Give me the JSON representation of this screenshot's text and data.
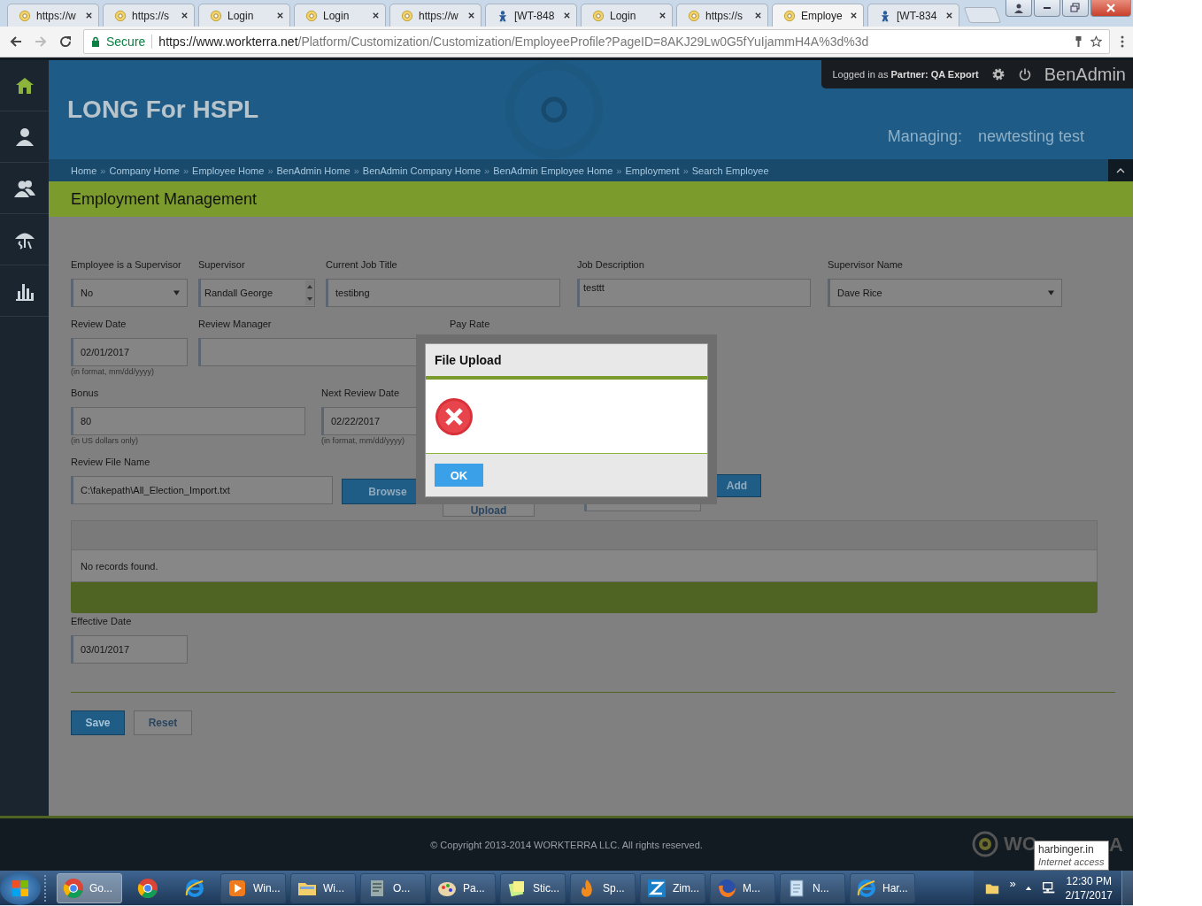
{
  "browser": {
    "tabs": [
      {
        "title": "https://w",
        "kind": "site",
        "selected": false
      },
      {
        "title": "https://s",
        "kind": "site",
        "selected": false
      },
      {
        "title": "Login",
        "kind": "site",
        "selected": false
      },
      {
        "title": "Login",
        "kind": "site",
        "selected": false
      },
      {
        "title": "https://w",
        "kind": "site",
        "selected": false
      },
      {
        "title": "[WT-848",
        "kind": "tracker",
        "selected": false
      },
      {
        "title": "Login",
        "kind": "site",
        "selected": false
      },
      {
        "title": "https://s",
        "kind": "site",
        "selected": false
      },
      {
        "title": "Employe",
        "kind": "site",
        "selected": true
      },
      {
        "title": "[WT-834",
        "kind": "tracker",
        "selected": false
      }
    ],
    "secure_label": "Secure",
    "url_host": "https://www.workterra.net",
    "url_path": "/Platform/Customization/Customization/EmployeeProfile?PageID=8AKJ29Lw0G5fYuIjammH4A%3d%3d"
  },
  "sidebar": {
    "items": [
      {
        "kind": "home",
        "selected": true
      },
      {
        "kind": "person",
        "selected": false
      },
      {
        "kind": "people",
        "selected": false
      },
      {
        "kind": "umbrella",
        "selected": false
      },
      {
        "kind": "chart",
        "selected": false
      }
    ]
  },
  "header": {
    "title": "LONG For HSPL",
    "login": "Logged in as **Partner:  QA Export**",
    "app_name": "BenAdmin",
    "managing_label": "Managing:",
    "managing_value": "newtesting test"
  },
  "breadcrumbs": [
    {
      "label": "Home",
      "separator": "»"
    },
    {
      "label": "Company Home",
      "separator": "»"
    },
    {
      "label": "Employee Home",
      "separator": "»"
    },
    {
      "label": "BenAdmin Home",
      "separator": "»"
    },
    {
      "label": "BenAdmin Company Home",
      "separator": "»"
    },
    {
      "label": "BenAdmin Employee Home",
      "separator": "»"
    },
    {
      "label": "Employment",
      "separator": "»"
    },
    {
      "label": "Search Employee"
    }
  ],
  "section_title": "Employment Management",
  "form": {
    "rows": [
      [
        {
          "label": "Employee is a Supervisor",
          "value": "No",
          "kind": "select"
        },
        {
          "label": "Supervisor",
          "value": "Randall George",
          "kind": "list"
        },
        {
          "label": "Current Job Title",
          "value": "testibng",
          "kind": "text"
        },
        {
          "label": "Job Description",
          "value": "testtt",
          "kind": "textarea"
        },
        {
          "label": "Supervisor Name",
          "value": "Dave Rice",
          "kind": "select"
        }
      ],
      [
        {
          "label": "Review Date",
          "value": "02/01/2017",
          "kind": "text",
          "hint": "(in format, mm/dd/yyyy)"
        },
        {
          "label": "Review Manager",
          "kind": "text"
        },
        {
          "label": "Pay Rate"
        }
      ],
      [
        {
          "label": "Bonus",
          "value": "80",
          "kind": "text",
          "hint": "(in US dollars only)"
        },
        {
          "label": "Next Review Date",
          "value": "02/22/2017",
          "kind": "text",
          "hint": "(in format, mm/dd/yyyy)"
        }
      ]
    ],
    "file_row": {
      "label": "Review File Name",
      "value": "C:\\fakepath\\All_Election_Import.txt",
      "browse": "Browse",
      "upload": "Upload",
      "add": "Add"
    },
    "table": {
      "message": "No records found."
    },
    "effective_date": {
      "label": "Effective Date",
      "value": "03/01/2017"
    },
    "buttons": [
      "Save",
      "Reset"
    ]
  },
  "modal": {
    "title": "File Upload",
    "button": "OK"
  },
  "footer": {
    "copyright": "© Copyright 2013-2014 WORKTERRA LLC. All rights reserved.",
    "logo_left": "WO",
    "logo_right": "A"
  },
  "taskbar": {
    "items": [
      {
        "kind": "chrome",
        "label": "Go...",
        "selected": true
      },
      {
        "kind": "chrome",
        "selected": false
      },
      {
        "kind": "ie",
        "selected": false
      },
      {
        "kind": "media",
        "label": "Win...",
        "selected": false
      },
      {
        "kind": "folder",
        "label": "Wi...",
        "selected": false
      },
      {
        "kind": "scroll",
        "label": "O...",
        "selected": false
      },
      {
        "kind": "paint",
        "label": "Pa...",
        "selected": false
      },
      {
        "kind": "notes",
        "label": "Stic...",
        "selected": false
      },
      {
        "kind": "flame",
        "label": "Sp...",
        "selected": false
      },
      {
        "kind": "zim",
        "label": "Zim...",
        "selected": false
      },
      {
        "kind": "firefox",
        "label": "M...",
        "selected": false
      },
      {
        "kind": "notepad",
        "label": "N...",
        "selected": false
      },
      {
        "kind": "ie",
        "label": "Har...",
        "selected": false
      }
    ],
    "chevron": "»",
    "time": "12:30 PM",
    "date": "2/17/2017",
    "tooltip": {
      "title": "harbinger.in",
      "subtitle": "Internet access"
    }
  }
}
